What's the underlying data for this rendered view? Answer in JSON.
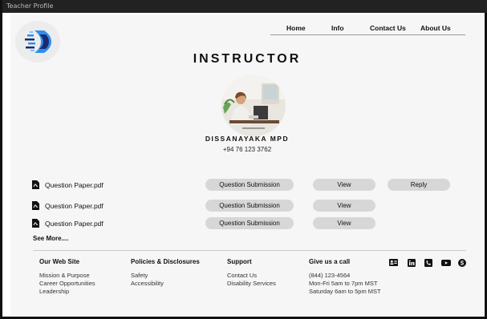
{
  "window": {
    "title": "Teacher Profile"
  },
  "nav": {
    "home": "Home",
    "info": "Info",
    "contact": "Contact Us",
    "about": "About Us"
  },
  "profile": {
    "heading": "INSTRUCTOR",
    "name": "DISSANAYAKA MPD",
    "phone": "+94 76 123 3762"
  },
  "files": [
    {
      "name": "Question Paper.pdf",
      "submission": "Question Submission",
      "view": "View",
      "reply": "Reply"
    },
    {
      "name": "Question Paper.pdf",
      "submission": "Question Submission",
      "view": "View"
    },
    {
      "name": "Question Paper.pdf",
      "submission": "Question Submission",
      "view": "View"
    }
  ],
  "see_more": "See More....",
  "footer": {
    "website": {
      "heading": "Our Web Site",
      "items": [
        "Mission & Purpose",
        "Career Opportunities",
        "Leadership"
      ]
    },
    "policies": {
      "heading": "Policies & Disclosures",
      "items": [
        "Safety",
        "Accessibility"
      ]
    },
    "support": {
      "heading": "Support",
      "items": [
        "Contact Us",
        "Disability Services"
      ]
    },
    "call": {
      "heading": "Give us a call",
      "items": [
        "(844) 123-4564",
        "Mon-Fri 5am to 7pm MST",
        "Saturday 6am to 5pm MST"
      ]
    }
  },
  "social_icons": [
    "contact-card-icon",
    "linkedin-icon",
    "phone-icon",
    "youtube-icon",
    "skype-icon"
  ],
  "colors": {
    "pill": "#d7d7d7",
    "logo_blue": "#2f8df0",
    "logo_dark": "#1b2a6b"
  }
}
